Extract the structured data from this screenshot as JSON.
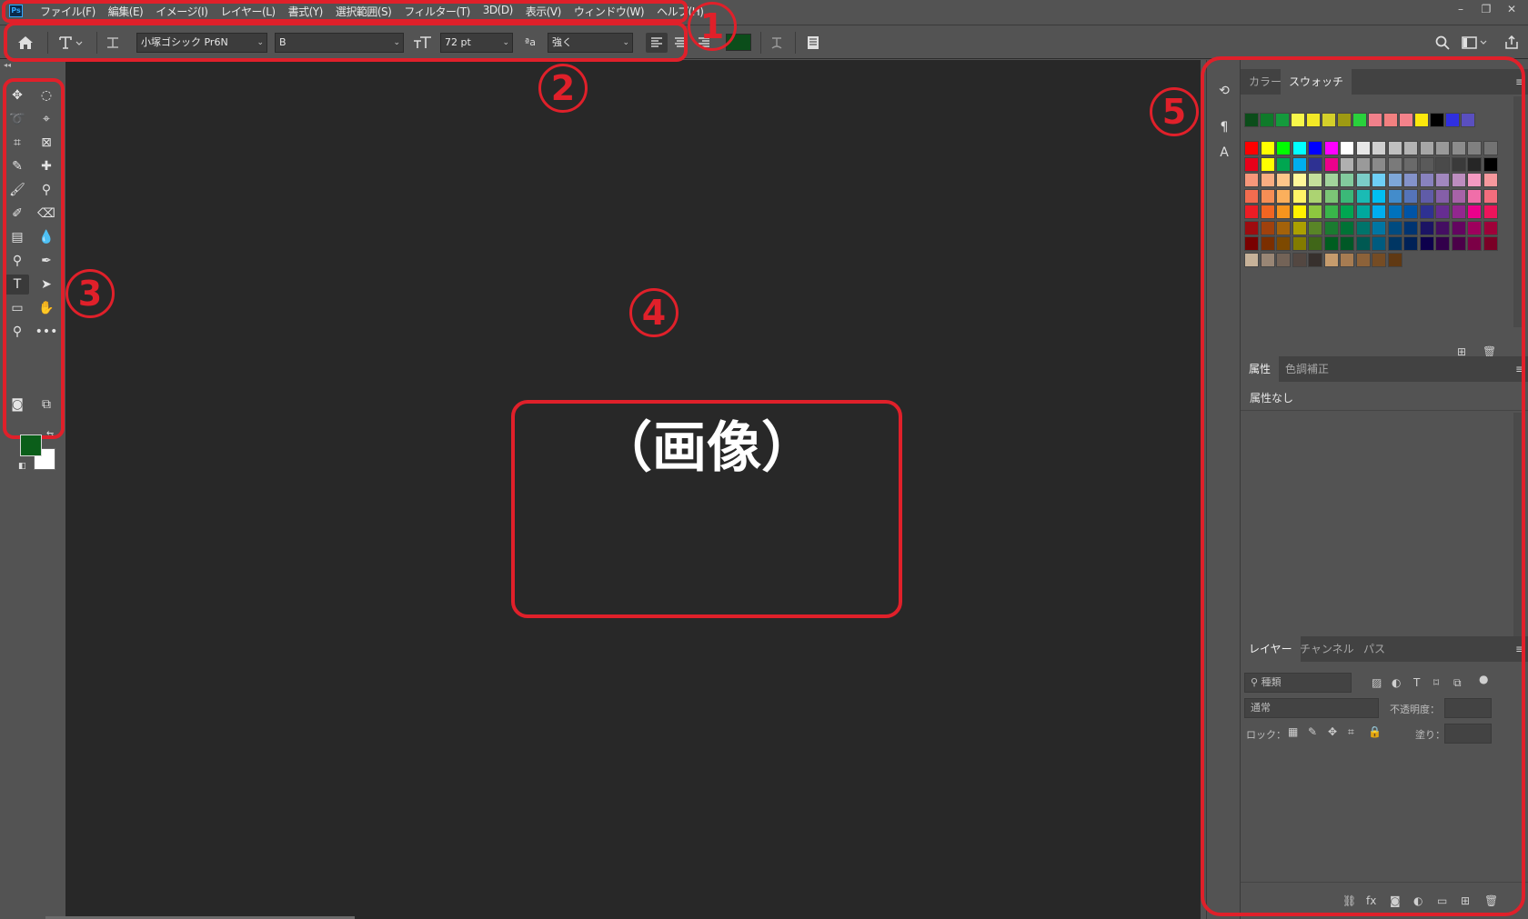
{
  "app": {
    "logo_text": "Ps"
  },
  "menubar": {
    "items": [
      "ファイル(F)",
      "編集(E)",
      "イメージ(I)",
      "レイヤー(L)",
      "書式(Y)",
      "選択範囲(S)",
      "フィルター(T)",
      "3D(D)",
      "表示(V)",
      "ウィンドウ(W)",
      "ヘルプ(H)"
    ],
    "window_controls": [
      "–",
      "❐",
      "✕"
    ]
  },
  "options_bar": {
    "font_family": "小塚ゴシック Pr6N",
    "font_style": "B",
    "font_size": "72 pt",
    "antialias_icon_text": "ªa",
    "antialias": "強く",
    "text_color": "#0b4d1a"
  },
  "tools": {
    "foreground_color": "#0b5e1a",
    "background_color": "#ffffff"
  },
  "canvas": {
    "placeholder": "（画像）"
  },
  "panels": {
    "color_tabs": [
      "カラー",
      "スウォッチ"
    ],
    "recent_swatches": [
      "#0b4d1a",
      "#0f7a2a",
      "#149a3c",
      "#f7f74a",
      "#f2e826",
      "#d4cf2a",
      "#9e9a12",
      "#2ad13c",
      "#f0808a",
      "#f28080",
      "#f4828a",
      "#fce80c",
      "#000000",
      "#2f2fe0",
      "#5a4fbf"
    ],
    "swatch_rows": [
      [
        "#ff0000",
        "#ffff00",
        "#00ff00",
        "#00ffff",
        "#0000ff",
        "#ff00ff",
        "#ffffff",
        "#e6e6e6",
        "#d0d0d0",
        "#c0c0c0",
        "#b3b3b3",
        "#a6a6a6",
        "#999999",
        "#8c8c8c",
        "#808080",
        "#737373"
      ],
      [
        "#e8001a",
        "#ffff00",
        "#00a650",
        "#00aeef",
        "#2e3192",
        "#ec008c",
        "#b0b0b0",
        "#9a9a9a",
        "#8a8a8a",
        "#7a7a7a",
        "#6a6a6a",
        "#5a5a5a",
        "#4a4a4a",
        "#3a3a3a",
        "#262626",
        "#000000"
      ],
      [
        "#f7977a",
        "#f9ad81",
        "#fdc68a",
        "#fff79a",
        "#c4df9b",
        "#a2d39c",
        "#82ca9d",
        "#7bcdc8",
        "#6ecff6",
        "#7ea7d8",
        "#8493ca",
        "#8882be",
        "#a187be",
        "#bc8dbf",
        "#f49ac2",
        "#f6989d"
      ],
      [
        "#f26c4f",
        "#f68e55",
        "#fbaf5c",
        "#fff467",
        "#acd372",
        "#7cc576",
        "#3bb878",
        "#1abbb4",
        "#00bff3",
        "#438ccb",
        "#5574b9",
        "#605ca8",
        "#855fa8",
        "#a763a8",
        "#f06ea9",
        "#f26d7d"
      ],
      [
        "#ed1c24",
        "#f26522",
        "#f7941d",
        "#fff200",
        "#8dc73f",
        "#39b54a",
        "#00a651",
        "#00a99d",
        "#00aeef",
        "#0072bc",
        "#0054a6",
        "#2e3192",
        "#662d91",
        "#92278f",
        "#ec008c",
        "#ed145b"
      ],
      [
        "#9e0b0f",
        "#a0410d",
        "#a3620a",
        "#aba000",
        "#598527",
        "#1a7b30",
        "#007236",
        "#00746b",
        "#0076a3",
        "#004b80",
        "#003471",
        "#1b1464",
        "#440e62",
        "#630460",
        "#9e005d",
        "#9e0039"
      ],
      [
        "#790000",
        "#7b2e00",
        "#7d4900",
        "#827b00",
        "#406618",
        "#005e20",
        "#005826",
        "#005952",
        "#005b7f",
        "#003663",
        "#002157",
        "#0d004c",
        "#32004b",
        "#4b0049",
        "#7b0046",
        "#7a0026"
      ],
      [
        "#c7b299",
        "#998675",
        "#736357",
        "#534741",
        "#37302d",
        "#c69c6d",
        "#a67c52",
        "#8c6239",
        "#754c24",
        "#603913"
      ]
    ],
    "properties_tabs": [
      "属性",
      "色調補正"
    ],
    "properties_empty": "属性なし",
    "layers_tabs": [
      "レイヤー",
      "チャンネル",
      "パス"
    ],
    "layers": {
      "filter_placeholder": "種類",
      "blend_mode": "通常",
      "opacity_label": "不透明度：",
      "lock_label": "ロック：",
      "fill_label": "塗り："
    }
  },
  "annotations": [
    "1",
    "2",
    "3",
    "4",
    "5"
  ]
}
